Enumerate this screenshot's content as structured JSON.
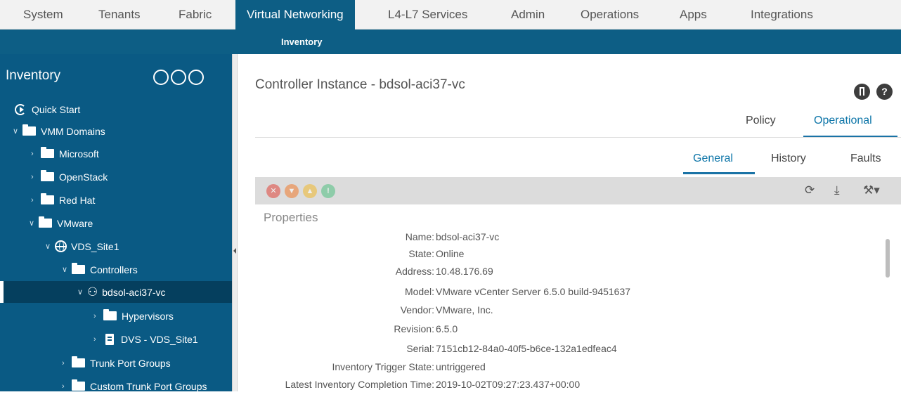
{
  "topnav": {
    "tabs": [
      {
        "label": "System"
      },
      {
        "label": "Tenants"
      },
      {
        "label": "Fabric"
      },
      {
        "label": "Virtual Networking"
      },
      {
        "label": "L4-L7 Services"
      },
      {
        "label": "Admin"
      },
      {
        "label": "Operations"
      },
      {
        "label": "Apps"
      },
      {
        "label": "Integrations"
      }
    ],
    "active": "Virtual Networking"
  },
  "subnav": {
    "label": "Inventory"
  },
  "sidebar": {
    "title": "Inventory",
    "header_icons": [
      "filter-icon",
      "list-icon",
      "power-icon"
    ],
    "items": [
      {
        "label": "Quick Start",
        "icon": "quick-start-icon"
      },
      {
        "label": "VMM Domains",
        "icon": "folder-icon",
        "expanded": true
      },
      {
        "label": "Microsoft",
        "icon": "folder-icon"
      },
      {
        "label": "OpenStack",
        "icon": "folder-icon"
      },
      {
        "label": "Red Hat",
        "icon": "folder-icon"
      },
      {
        "label": "VMware",
        "icon": "folder-icon",
        "expanded": true
      },
      {
        "label": "VDS_Site1",
        "icon": "globe-icon",
        "expanded": true
      },
      {
        "label": "Controllers",
        "icon": "folder-icon",
        "expanded": true
      },
      {
        "label": "bdsol-aci37-vc",
        "icon": "controller-icon",
        "expanded": true,
        "selected": true
      },
      {
        "label": "Hypervisors",
        "icon": "folder-icon"
      },
      {
        "label": "DVS - VDS_Site1",
        "icon": "document-icon"
      },
      {
        "label": "Trunk Port Groups",
        "icon": "folder-icon"
      },
      {
        "label": "Custom Trunk Port Groups",
        "icon": "folder-icon"
      }
    ]
  },
  "main": {
    "title": "Controller Instance - bdsol-aci37-vc",
    "help_label": "?",
    "view_tabs": [
      {
        "label": "Policy"
      },
      {
        "label": "Operational"
      }
    ],
    "view_tabs_active": "Operational",
    "sub_tabs": [
      {
        "label": "General"
      },
      {
        "label": "History"
      },
      {
        "label": "Faults"
      }
    ],
    "sub_tabs_active": "General",
    "fault_icons": [
      {
        "name": "critical-fault-icon",
        "color": "#e0443a"
      },
      {
        "name": "major-fault-icon",
        "color": "#f07a2d"
      },
      {
        "name": "minor-fault-icon",
        "color": "#f0b92d"
      },
      {
        "name": "warning-fault-icon",
        "color": "#4fbf80"
      }
    ],
    "properties_title": "Properties",
    "properties": [
      {
        "key": "Name:",
        "value": "bdsol-aci37-vc"
      },
      {
        "key": "State:",
        "value": "Online"
      },
      {
        "key": "Address:",
        "value": "10.48.176.69"
      },
      {
        "key": "Model:",
        "value": "VMware vCenter Server 6.5.0 build-9451637"
      },
      {
        "key": "Vendor:",
        "value": "VMware, Inc."
      },
      {
        "key": "Revision:",
        "value": "6.5.0"
      },
      {
        "key": "Serial:",
        "value": "7151cb12-84a0-40f5-b6ce-132a1edfeac4"
      },
      {
        "key": "Inventory Trigger State:",
        "value": "untriggered"
      },
      {
        "key": "Latest Inventory Completion Time:",
        "value": "2019-10-02T09:27:23.437+00:00"
      }
    ]
  },
  "colors": {
    "nav_active": "#0d5e85",
    "sidebar_bg": "#0a5a84",
    "accent": "#1a73a6"
  }
}
